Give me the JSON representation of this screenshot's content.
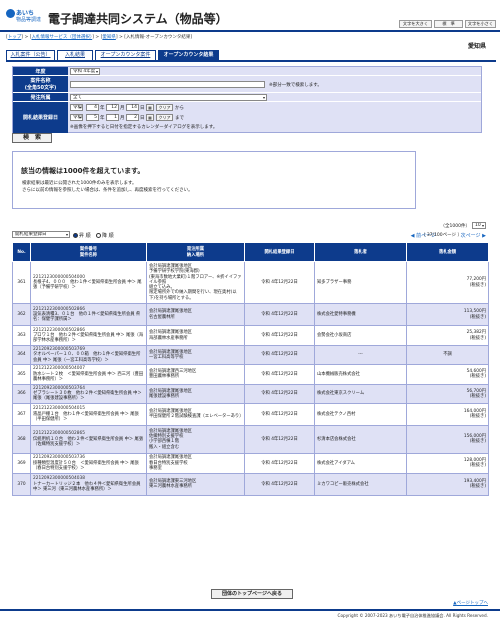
{
  "header": {
    "logo_line1": "あいち",
    "logo_line2": "物品等調達",
    "title": "電子調達共同システム（物品等）",
    "font_large": "文字を大きく",
    "font_standard": "標　準",
    "font_small": "文字を小さく"
  },
  "breadcrumb": {
    "top": "トップ",
    "service": "入札情報サービス（団体選択）",
    "pref": "愛知県",
    "current": "入札情報-オープンカウンタ結果",
    "sep": " > "
  },
  "prefecture": "愛知県",
  "tabs": [
    "入札案件（公告）",
    "入札結果",
    "オープンカウンタ案件",
    "オープンカウンタ結果"
  ],
  "form": {
    "fiscal_year_label": "年度",
    "fiscal_year_value": "令和 4年度",
    "case_name_label": "案件名称",
    "case_name_sub": "(全角50文字)",
    "case_name_note": "※部分一致で検索します。",
    "org_label": "発注所属",
    "org_value": "全て",
    "date_label": "開札結果登録日",
    "era": "令和",
    "from_y": "4",
    "from_m": "12",
    "from_d": "14",
    "to_y": "5",
    "to_m": "1",
    "to_d": "2",
    "unit_y": "年",
    "unit_m": "月",
    "unit_d": "日",
    "cal_icon": "カレンダー",
    "clear": "クリア",
    "from_suffix": "から",
    "to_suffix": "まで",
    "date_note": "※画像を押下すると日付を指定するカレンダーダイアログを表示します。",
    "search_button": "検　索"
  },
  "notice": {
    "title": "該当の情報は1000件を超えています。",
    "line1": "検索結果は最近に公開された1000件のみを表示します。",
    "line2": "さらに以前の情報を参照したい場合は、条件を追加し、再度検索を行ってください。"
  },
  "pager": {
    "total": "（全1000件）",
    "per_page": "10",
    "per_suffix": "件",
    "prev": "前ページ",
    "info": "（ 37/100ページ ）",
    "next": "次ページ",
    "sort_value": "開札結果登録日",
    "asc": "昇 順",
    "desc": "降 順"
  },
  "table": {
    "headers": [
      "No.",
      "案件番号\n案件名称",
      "発注所属\n納入場所",
      "開札結果登録日",
      "落札者",
      "落札金額"
    ],
    "rows": [
      {
        "no": "361",
        "code": "2212123000000504000",
        "title": "長根子4、０００　他わ１件＜愛知県衛生所会員 中＞ 尾張（予備学研学校）＞",
        "org": "会計局調達課尾張地区\n予備学研学校学院(東海郡)\n(東海市数地大業町)１階フロアー、※折イイファイル参照\n組立て込み。\n限定場所外での納入期間を行い、現在奥村(以下)を持ち場所とする。",
        "date": "令和 4年12月22日",
        "winner": "知多ブラザー事務",
        "amount": "77,200円",
        "tax": "(税抜き)"
      },
      {
        "no": "362",
        "code": "2212122300000502866",
        "title": "設気表清積3、０１台　他の１件＜愛知県衛生所会員 県名：保健学課所属＞",
        "org": "会計局調達課尾張地区\n名古屋農林所",
        "date": "令和 4年12月22日",
        "winner": "株式会社愛特事務機",
        "amount": "113,500円",
        "tax": "(税抜き)"
      },
      {
        "no": "363",
        "code": "2212122300000502866",
        "title": "プロワ１台　他わ２件＜愛知県衛生所会員 中＞ 尾張（海部学林水産事務所）＞",
        "org": "会計局調達課尾張地区\n海部農林水産事務所",
        "date": "令和 4年12月22日",
        "winner": "会勢会社小坂商店",
        "amount": "25,382円",
        "tax": "(税抜き)"
      },
      {
        "no": "364",
        "code": "2212092300000503769",
        "title": "タオルペーパー１０、００箱　他わ１件＜愛知県衛生所 会員 中＞ 尾張（一宮工科高等学校）＞",
        "org": "会計局調達課尾張地区\n一宮工科高等学校",
        "date": "令和 4年12月22日",
        "winner": "---",
        "amount": "不調",
        "tax": ""
      },
      {
        "no": "365",
        "code": "2212122300000504007",
        "title": "防水シート２枚　＜愛知県衛生所会員 中＞ 西三河（豊田農林事務所）＞",
        "org": "会計局調達課西三河地区\n豊田農林事務所",
        "date": "令和 4年12月22日",
        "winner": "山本機械販売株式会社",
        "amount": "54,600円",
        "tax": "(税抜き)"
      },
      {
        "no": "366",
        "code": "2212092300000503764",
        "title": "ゼブラシート３０枚　他わ２件＜愛知県衛生所会員 中＞ 尾張（尾張建設事務所）＞",
        "org": "会計局調達課尾張地区\n尾張建設事務所",
        "date": "令和 4年12月22日",
        "winner": "株式会社東京スクリーム",
        "amount": "56,700円",
        "tax": "(税抜き)"
      },
      {
        "no": "367",
        "code": "2212122300000504015",
        "title": "液晶戸棚１台　他わ１件＜愛知県衛生所会員 中＞ 尾張（半田保健所）＞",
        "org": "会計局調達課尾張地区\n半田保健所２階試験検査課（エレベーターあり）",
        "date": "令和 4年12月22日",
        "winner": "株式会社テクノ西村",
        "amount": "164,000円",
        "tax": "(税抜き)"
      },
      {
        "no": "368",
        "code": "2212122300000502865",
        "title": "伝統用机１０台　他わ２件＜愛知県衛生所会員 中＞ 尾張（佐織特別支援学校）＞",
        "org": "会計局調達課尾張地区\n佐織特別支援学校\n小学部西棟１階\n搬入・組立含む",
        "date": "令和 4年12月22日",
        "winner": "杉清本店会株式会社",
        "amount": "156,000円",
        "tax": "(税抜き)"
      },
      {
        "no": "369",
        "code": "2212092300000503736",
        "title": "掛種類型温度計５０台　＜愛知県衛生所会員 中＞ 尾張（春日台特別支援学校）＞",
        "org": "会計局調達課尾張地区\n春日台特別支援学校\n事務室",
        "date": "令和 4年12月22日",
        "winner": "株式会社アイダアム",
        "amount": "128,000円",
        "tax": "(税抜き)"
      },
      {
        "no": "370",
        "code": "2212092300000504038",
        "title": "トナーカートリッジ２本　他わ４件＜愛知県衛生所会員 中＞ 東三河（東三河農林水産事務所）＞",
        "org": "会計局調達課東三河地区\n東三河農林水産事務所",
        "date": "令和 4年12月22日",
        "winner": "ミカワコピー販売株式会社",
        "amount": "193,400円",
        "tax": "(税抜き)"
      }
    ]
  },
  "back_button": "団体のトップページへ戻る",
  "to_top": "ページトップへ",
  "copyright": "Copyright © 2007-2023 あいち電子自治体推進協議会. All Rights Reserved.",
  "colors": {
    "primary": "#0d3b8c",
    "row_alt": "#dfe1f5",
    "link": "#1565c0"
  }
}
